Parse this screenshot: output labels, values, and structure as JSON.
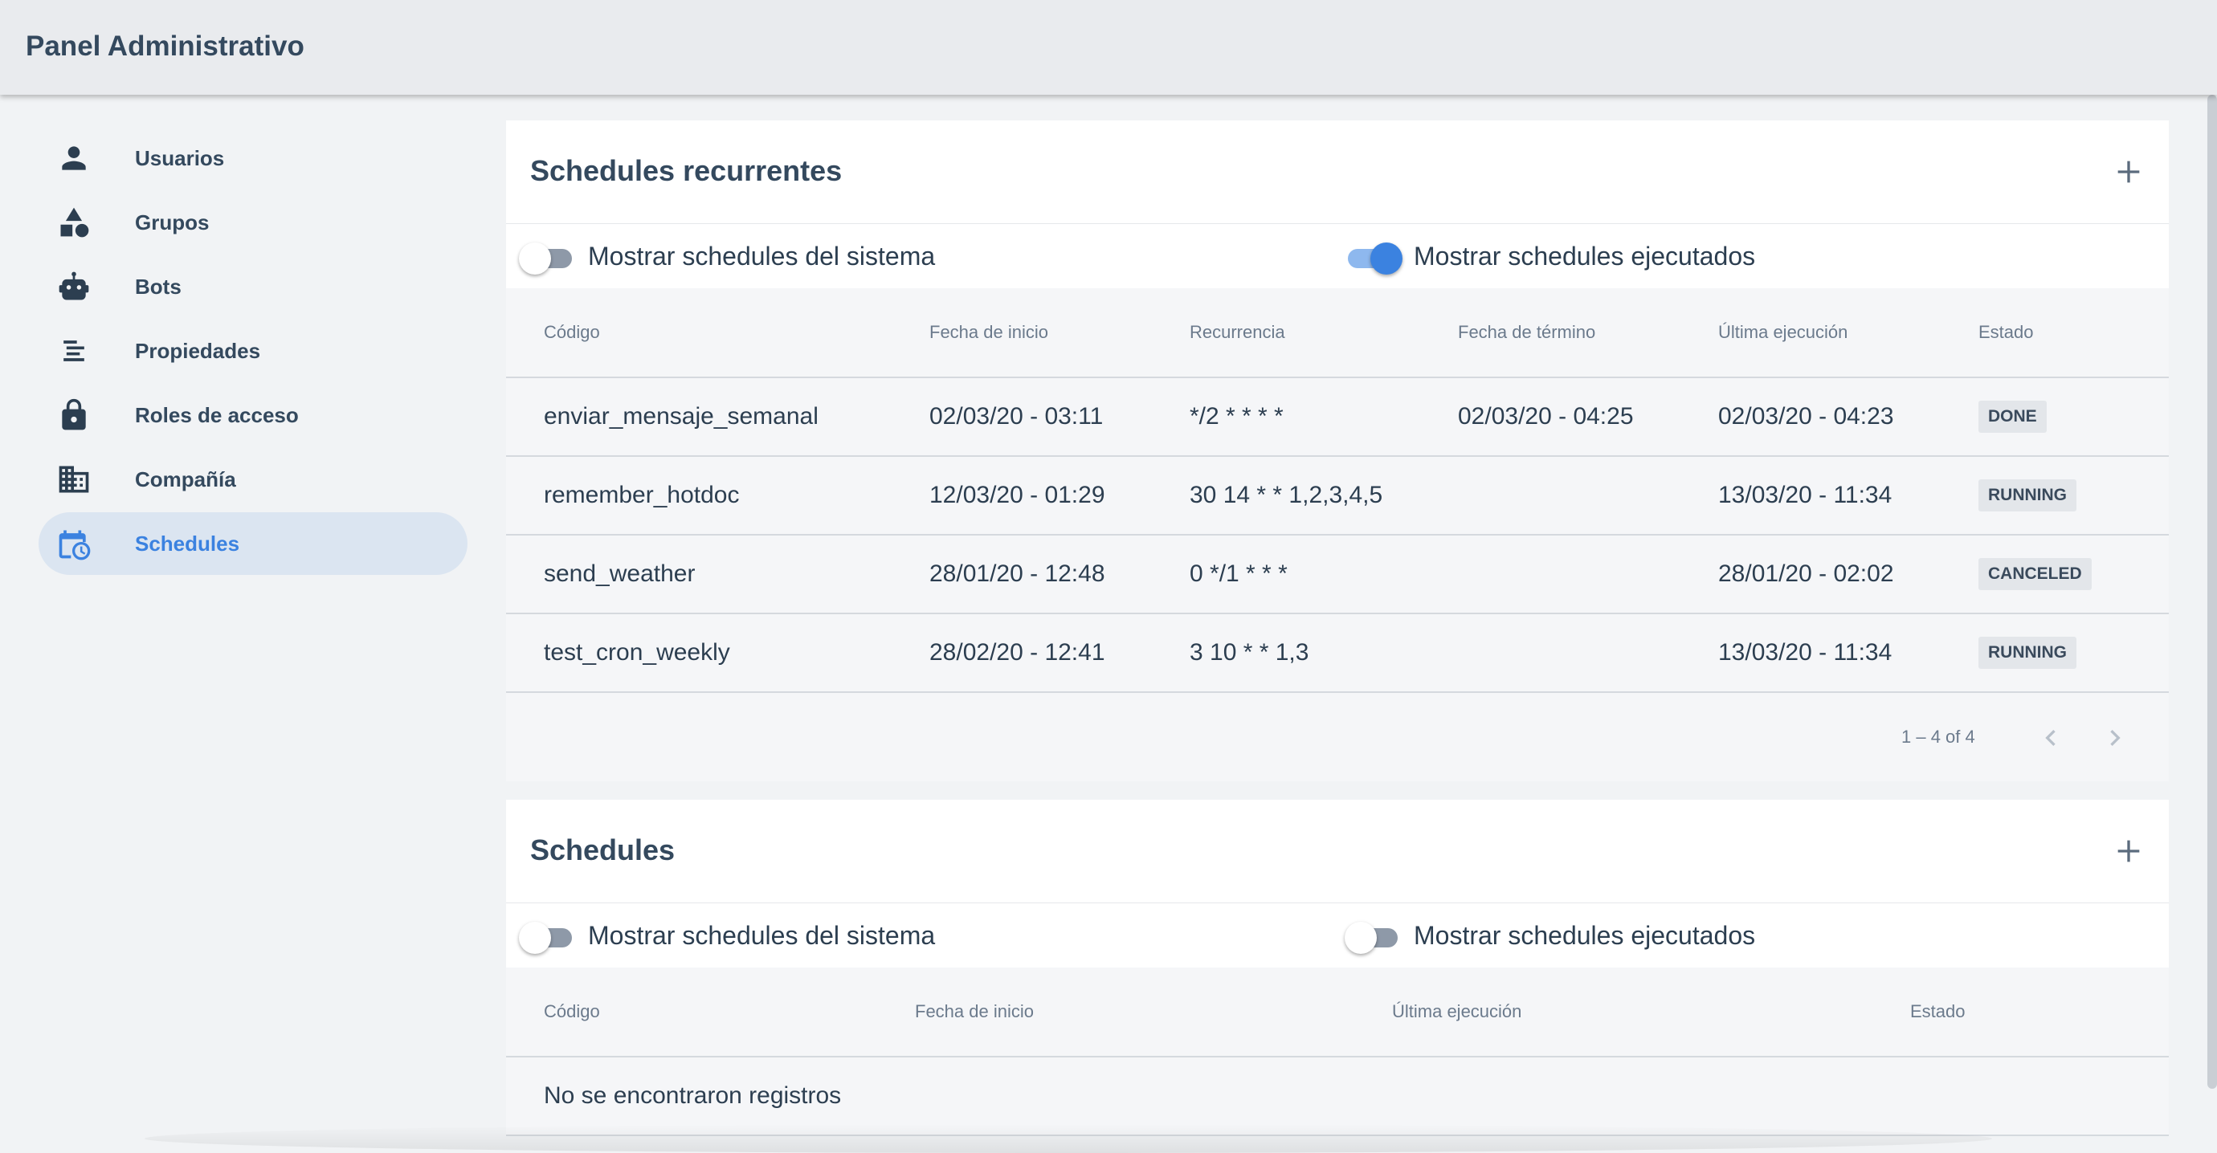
{
  "app": {
    "title": "Panel Administrativo"
  },
  "sidebar": {
    "items": [
      {
        "label": "Usuarios",
        "icon": "person-icon",
        "active": false
      },
      {
        "label": "Grupos",
        "icon": "shapes-icon",
        "active": false
      },
      {
        "label": "Bots",
        "icon": "robot-icon",
        "active": false
      },
      {
        "label": "Propiedades",
        "icon": "properties-icon",
        "active": false
      },
      {
        "label": "Roles de acceso",
        "icon": "lock-icon",
        "active": false
      },
      {
        "label": "Compañía",
        "icon": "building-icon",
        "active": false
      },
      {
        "label": "Schedules",
        "icon": "calendar-clock-icon",
        "active": true
      }
    ]
  },
  "recurring": {
    "title": "Schedules recurrentes",
    "toggle_system_label": "Mostrar schedules del sistema",
    "toggle_system_on": false,
    "toggle_executed_label": "Mostrar schedules ejecutados",
    "toggle_executed_on": true,
    "columns": [
      "Código",
      "Fecha de inicio",
      "Recurrencia",
      "Fecha de término",
      "Última ejecución",
      "Estado"
    ],
    "rows": [
      {
        "code": "enviar_mensaje_semanal",
        "start": "02/03/20 - 03:11",
        "recurrence": "*/2 * * * *",
        "end": "02/03/20 - 04:25",
        "last": "02/03/20 - 04:23",
        "status": "DONE"
      },
      {
        "code": "remember_hotdoc",
        "start": "12/03/20 - 01:29",
        "recurrence": "30 14 * * 1,2,3,4,5",
        "end": "",
        "last": "13/03/20 - 11:34",
        "status": "RUNNING"
      },
      {
        "code": "send_weather",
        "start": "28/01/20 - 12:48",
        "recurrence": "0 */1 * * *",
        "end": "",
        "last": "28/01/20 - 02:02",
        "status": "CANCELED"
      },
      {
        "code": "test_cron_weekly",
        "start": "28/02/20 - 12:41",
        "recurrence": "3 10 * * 1,3",
        "end": "",
        "last": "13/03/20 - 11:34",
        "status": "RUNNING"
      }
    ],
    "pagination": "1 – 4 of 4"
  },
  "schedules": {
    "title": "Schedules",
    "toggle_system_label": "Mostrar schedules del sistema",
    "toggle_system_on": false,
    "toggle_executed_label": "Mostrar schedules ejecutados",
    "toggle_executed_on": false,
    "columns": [
      "Código",
      "Fecha de inicio",
      "Última ejecución",
      "Estado"
    ],
    "empty_message": "No se encontraron registros"
  },
  "colors": {
    "accent": "#3b82e0",
    "active_nav_bg": "#dbe5f1",
    "text": "#2c3e50"
  }
}
